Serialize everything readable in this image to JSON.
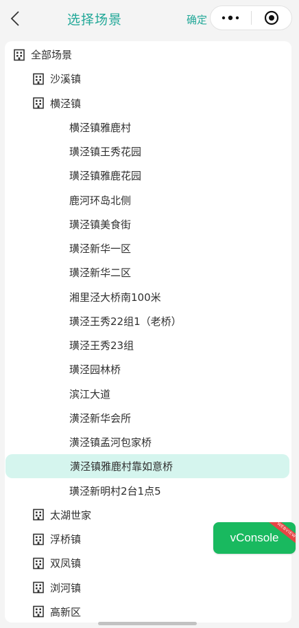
{
  "header": {
    "title": "选择场景",
    "confirm_label": "确定",
    "back_icon": "chevron-left-icon",
    "more_icon": "more-dots-icon",
    "close_icon": "target-circle-icon"
  },
  "tree": {
    "root": "全部场景",
    "towns": [
      "沙溪镇",
      "横泾镇",
      "太湖世家",
      "浮桥镇",
      "双凤镇",
      "浏河镇",
      "高新区"
    ],
    "scenes": [
      "横泾镇雅鹿村",
      "璜泾镇王秀花园",
      "璜泾镇雅鹿花园",
      "鹿河环岛北侧",
      "璜泾镇美食街",
      "璜泾新华一区",
      "璜泾新华二区",
      "湘里泾大桥南100米",
      "璜泾王秀22组1（老桥）",
      "璜泾王秀23组",
      "璜泾园林桥",
      "滨江大道",
      "潢泾新华会所",
      "潢泾镇孟河包家桥",
      "潢泾镇雅鹿村靠如意桥",
      "璜泾新明村2台1点5"
    ],
    "selected": "潢泾镇雅鹿村靠如意桥"
  },
  "vconsole": {
    "label": "vConsole",
    "ribbon": "WEBVIEW"
  },
  "colors": {
    "accent": "#22a898",
    "selected_bg": "#d5f5ee",
    "vconsole_bg": "#19b95f"
  }
}
